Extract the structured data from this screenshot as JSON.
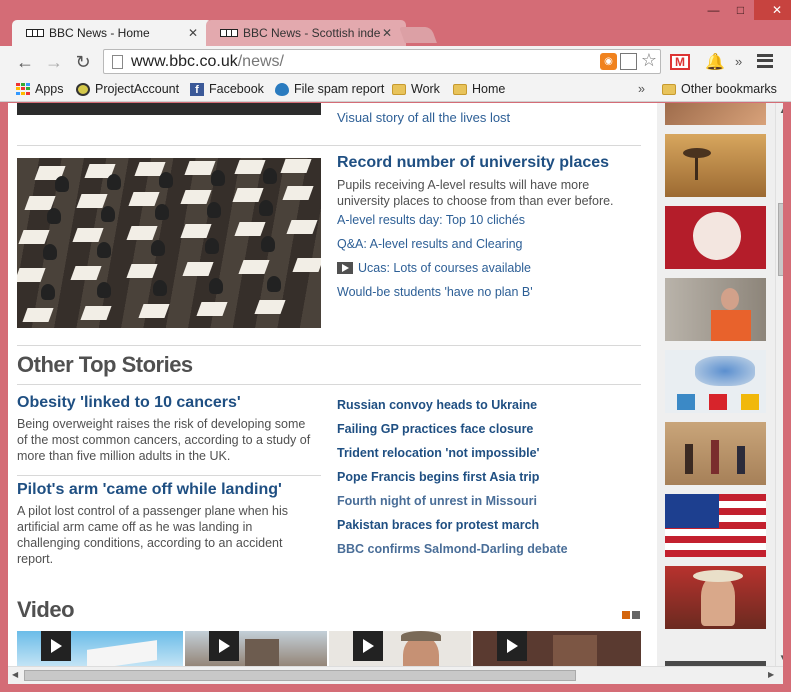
{
  "browser": {
    "tabs": [
      {
        "title": "BBC News - Home",
        "active": true
      },
      {
        "title": "BBC News - Scottish indep",
        "active": false
      }
    ],
    "url_host": "www.bbc.co.uk",
    "url_path": "/news/",
    "bookmarks": [
      {
        "label": "Apps",
        "icon": "apps-icon"
      },
      {
        "label": "ProjectAccount",
        "icon": "clock-icon"
      },
      {
        "label": "Facebook",
        "icon": "facebook-icon"
      },
      {
        "label": "File spam report",
        "icon": "drupal-icon"
      },
      {
        "label": "Work",
        "icon": "folder-icon"
      },
      {
        "label": "Home",
        "icon": "folder-icon"
      }
    ],
    "bookmarks_more": "»",
    "other_bookmarks": "Other bookmarks",
    "ext_more": "»",
    "gmail_letter": "M"
  },
  "page": {
    "top_link": "Visual story of all the lives lost",
    "lead": {
      "title": "Record number of university places",
      "description": "Pupils receiving A-level results will have more university places to choose from than ever before.",
      "related": [
        {
          "text": "A-level results day: Top 10 clichés",
          "video": false
        },
        {
          "text": "Q&A: A-level results and Clearing",
          "video": false
        },
        {
          "text": "Ucas: Lots of courses available",
          "video": true
        },
        {
          "text": "Would-be students 'have no plan B'",
          "video": false
        }
      ]
    },
    "other_top_stories": {
      "heading": "Other Top Stories",
      "stories": [
        {
          "title": "Obesity 'linked to 10 cancers'",
          "description": "Being overweight raises the risk of developing some of the most common cancers, according to a study of more than five million adults in the UK."
        },
        {
          "title": "Pilot's arm 'came off while landing'",
          "description": "A pilot lost control of a passenger plane when his artificial arm came off as he was landing in challenging conditions, according to an accident report."
        }
      ],
      "links": [
        {
          "text": "Russian convoy heads to Ukraine",
          "visited": false
        },
        {
          "text": "Failing GP practices face closure",
          "visited": false
        },
        {
          "text": "Trident relocation 'not impossible'",
          "visited": false
        },
        {
          "text": "Pope Francis begins first Asia trip",
          "visited": false
        },
        {
          "text": "Fourth night of unrest in Missouri",
          "visited": true
        },
        {
          "text": "Pakistan braces for protest march",
          "visited": false
        },
        {
          "text": "BBC confirms Salmond-Darling debate",
          "visited": true
        }
      ]
    },
    "video_heading": "Video",
    "colors": {
      "link": "#1f4f82",
      "visited": "#4a6e98",
      "text": "#505050",
      "pager_active": "#d4650d",
      "pager_inactive": "#666666"
    }
  }
}
